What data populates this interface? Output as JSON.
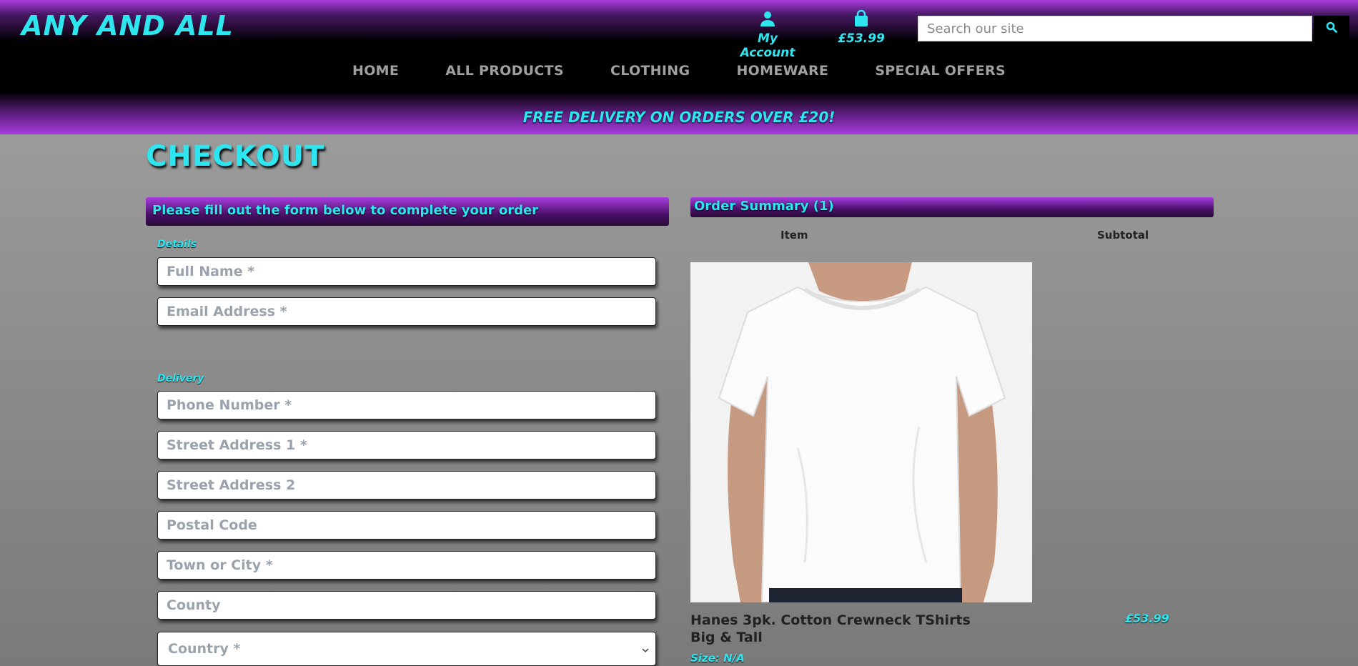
{
  "brand": {
    "name": "ANY AND ALL"
  },
  "header": {
    "account_label": "My Account",
    "bag_total": "£53.99",
    "search_placeholder": "Search our site"
  },
  "nav": {
    "items": [
      "HOME",
      "ALL PRODUCTS",
      "CLOTHING",
      "HOMEWARE",
      "SPECIAL OFFERS"
    ]
  },
  "banner": "FREE DELIVERY ON ORDERS OVER £20!",
  "page": {
    "title": "CHECKOUT"
  },
  "form": {
    "heading": "Please fill out the form below to complete your order",
    "details_legend": "Details",
    "delivery_legend": "Delivery",
    "placeholders": {
      "full_name": "Full Name *",
      "email": "Email Address *",
      "phone": "Phone Number *",
      "street1": "Street Address 1 *",
      "street2": "Street Address 2",
      "postcode": "Postal Code",
      "town": "Town or City *",
      "county": "County"
    },
    "country_selected": "Country *"
  },
  "summary": {
    "heading": "Order Summary (1)",
    "col_item": "Item",
    "col_subtotal": "Subtotal",
    "items": [
      {
        "name": "Hanes 3pk. Cotton Crewneck TShirts Big & Tall",
        "size": "Size: N/A",
        "price": "£53.99"
      }
    ]
  },
  "colors": {
    "accent": "#2ee6f0",
    "purple": "#a93de0",
    "dark": "#000000"
  },
  "icons": {
    "account": "user-icon",
    "bag": "shopping-bag-icon",
    "search": "search-icon",
    "select": "chevron-down-icon"
  }
}
